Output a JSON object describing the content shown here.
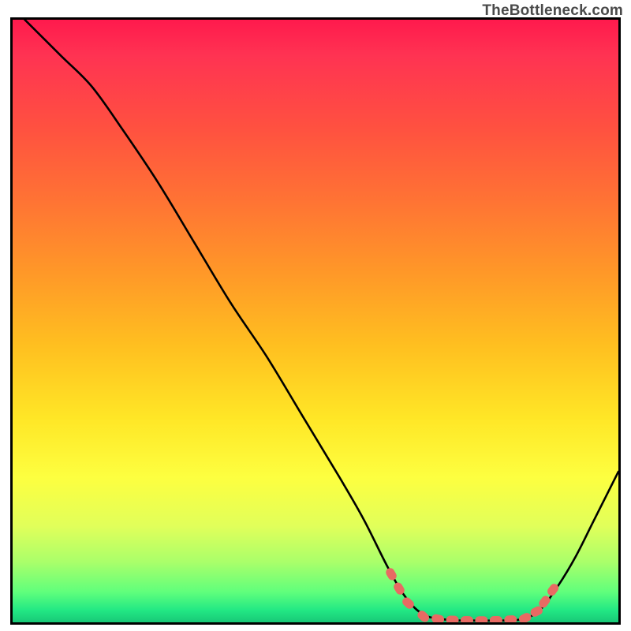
{
  "watermark": "TheBottleneck.com",
  "chart_data": {
    "type": "line",
    "title": "",
    "xlabel": "",
    "ylabel": "",
    "xlim": [
      0,
      100
    ],
    "ylim": [
      0,
      100
    ],
    "curve_note": "Bottleneck-style curve: steep descent from top-left reaching near-zero around x≈72, flat valley ≈62–85, then rising toward right edge.",
    "curve": [
      [
        2,
        100
      ],
      [
        8,
        94
      ],
      [
        13,
        89
      ],
      [
        18,
        82
      ],
      [
        24,
        73
      ],
      [
        30,
        63
      ],
      [
        36,
        53
      ],
      [
        42,
        44
      ],
      [
        48,
        34
      ],
      [
        54,
        24
      ],
      [
        58,
        17
      ],
      [
        62,
        9
      ],
      [
        65,
        4
      ],
      [
        68,
        1.2
      ],
      [
        72,
        0.4
      ],
      [
        76,
        0.3
      ],
      [
        80,
        0.3
      ],
      [
        84,
        0.5
      ],
      [
        87,
        2
      ],
      [
        90,
        6
      ],
      [
        93,
        11
      ],
      [
        96,
        17
      ],
      [
        100,
        25
      ]
    ],
    "markers_note": "Coral/salmon rounded dashes near valley bottom",
    "markers": [
      [
        62.5,
        8.0
      ],
      [
        63.8,
        5.6
      ],
      [
        65.3,
        3.2
      ],
      [
        67.8,
        1.0
      ],
      [
        70.2,
        0.55
      ],
      [
        72.6,
        0.38
      ],
      [
        75.0,
        0.32
      ],
      [
        77.4,
        0.3
      ],
      [
        79.8,
        0.33
      ],
      [
        82.2,
        0.42
      ],
      [
        84.6,
        0.7
      ],
      [
        86.5,
        1.8
      ],
      [
        87.8,
        3.4
      ],
      [
        89.2,
        5.4
      ]
    ],
    "marker_color": "#e86a63",
    "curve_color": "#000000",
    "gradient_stops": [
      [
        "0%",
        "#ff1a4d"
      ],
      [
        "30%",
        "#ff7334"
      ],
      [
        "66%",
        "#ffe626"
      ],
      [
        "90%",
        "#aaff6a"
      ],
      [
        "100%",
        "#18c877"
      ]
    ]
  }
}
